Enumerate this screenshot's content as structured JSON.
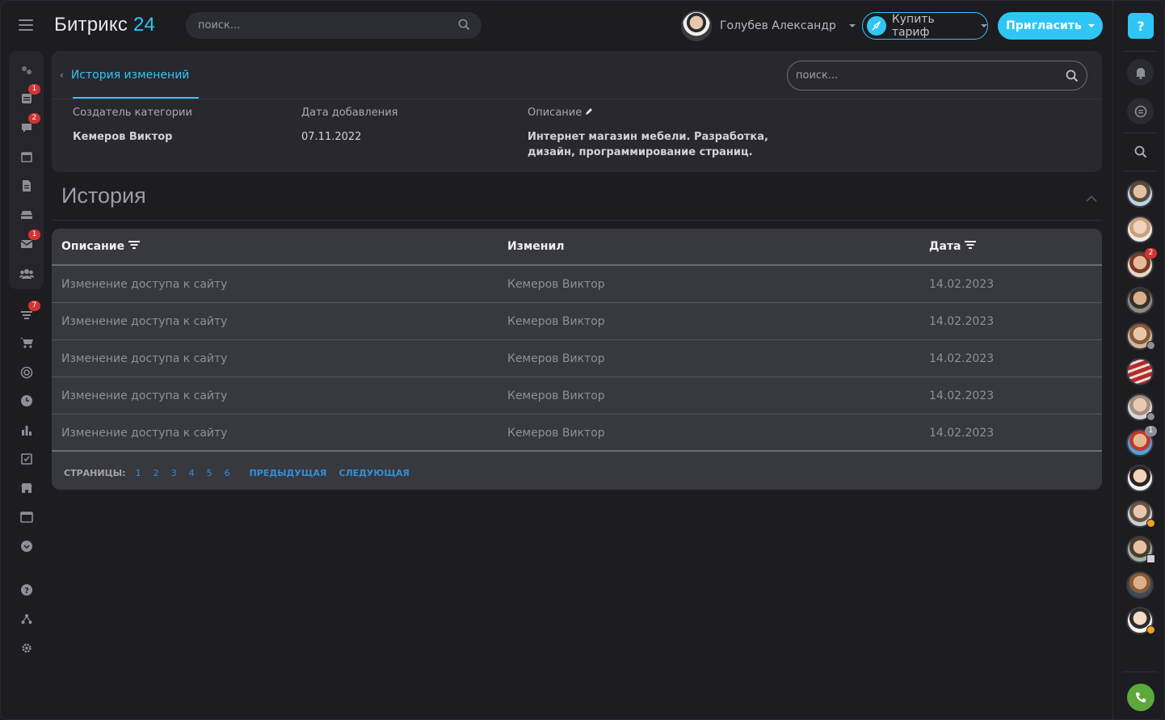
{
  "app": {
    "logo_text": "Битрикс",
    "logo_num": "24"
  },
  "top": {
    "search_placeholder": "поиск...",
    "user_name": "Голубев Александр",
    "tariff_label": "Купить тариф",
    "invite_label": "Пригласить"
  },
  "leftbar": {
    "badges": {
      "tasks": "1",
      "chat": "2",
      "mail": "1",
      "filter": "7"
    }
  },
  "info": {
    "tab_label": "История изменений",
    "search_placeholder": "поиск...",
    "creator_label": "Создатель категории",
    "creator_value": "Кемеров Виктор",
    "date_label": "Дата добавления",
    "date_value": "07.11.2022",
    "desc_label": "Описание",
    "desc_value_line1": "Интернет магазин мебели. Разработка,",
    "desc_value_line2": "дизайн, программирование страниц."
  },
  "history": {
    "title": "История",
    "columns": [
      "Описание",
      "Изменил",
      "Дата"
    ],
    "rows": [
      {
        "desc": "Изменение доступа к сайту",
        "by": "Кемеров Виктор",
        "date": "14.02.2023"
      },
      {
        "desc": "Изменение доступа к сайту",
        "by": "Кемеров Виктор",
        "date": "14.02.2023"
      },
      {
        "desc": "Изменение доступа к сайту",
        "by": "Кемеров Виктор",
        "date": "14.02.2023"
      },
      {
        "desc": "Изменение доступа к сайту",
        "by": "Кемеров Виктор",
        "date": "14.02.2023"
      },
      {
        "desc": "Изменение доступа к сайту",
        "by": "Кемеров Виктор",
        "date": "14.02.2023"
      }
    ],
    "pager": {
      "label": "СТРАНИЦЫ:",
      "pages": [
        "1",
        "2",
        "3",
        "4",
        "5",
        "6"
      ],
      "prev": "ПРЕДЫДУЩАЯ",
      "next": "СЛЕДУЮЩАЯ"
    }
  },
  "rightbar": {
    "help_symbol": "?",
    "badges": {
      "avatar3": "2",
      "avatar8": "1"
    }
  },
  "colors": {
    "accent": "#2fc6f6",
    "link": "#2f8fd8",
    "badge": "#d33434",
    "phone": "#5ca83a"
  }
}
